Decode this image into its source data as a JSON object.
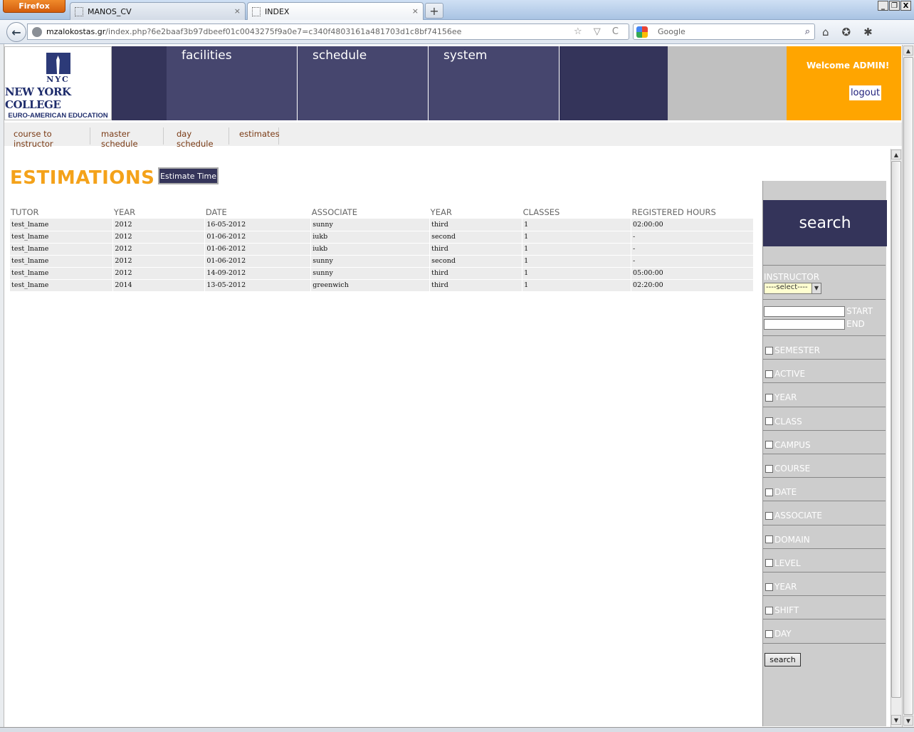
{
  "browser": {
    "app_button": "Firefox",
    "tabs": [
      {
        "label": "MANOS_CV",
        "close": "×"
      },
      {
        "label": "INDEX",
        "close": "×"
      }
    ],
    "new_tab": "+",
    "back": "←",
    "url_host": "mzalokostas.gr",
    "url_path": "/index.php?6e2baaf3b97dbeef01c0043275f9a0e7=c340f4803161a481703d1c8bf74156ee",
    "url_icons": "☆ ▽ C",
    "search_engine": "Google",
    "search_icon": "⌕",
    "window_buttons": [
      "_",
      "❐",
      "X"
    ],
    "tool_icons": [
      "⌂",
      "✪",
      "✱"
    ]
  },
  "logo": {
    "nyc": "NYC",
    "title": "NEW YORK COLLEGE",
    "subtitle": "EURO-AMERICAN EDUCATION"
  },
  "header": {
    "nav": [
      "facilities",
      "schedule",
      "system"
    ],
    "welcome": "Welcome ADMIN!",
    "logout": "logout"
  },
  "subnav": [
    "course to instructor",
    "master schedule",
    "day schedule",
    "estimates"
  ],
  "main": {
    "title": "ESTIMATIONS",
    "estimate_button": "Estimate Time",
    "columns": [
      "TUTOR",
      "YEAR",
      "DATE",
      "ASSOCIATE",
      "YEAR",
      "CLASSES",
      "REGISTERED HOURS"
    ],
    "rows": [
      [
        "test_lname",
        "2012",
        "16-05-2012",
        "sunny",
        "third",
        "1",
        "02:00:00"
      ],
      [
        "test_lname",
        "2012",
        "01-06-2012",
        "iukb",
        "second",
        "1",
        "-"
      ],
      [
        "test_lname",
        "2012",
        "01-06-2012",
        "iukb",
        "third",
        "1",
        "-"
      ],
      [
        "test_lname",
        "2012",
        "01-06-2012",
        "sunny",
        "second",
        "1",
        "-"
      ],
      [
        "test_lname",
        "2012",
        "14-09-2012",
        "sunny",
        "third",
        "1",
        "05:00:00"
      ],
      [
        "test_lname",
        "2014",
        "13-05-2012",
        "greenwich",
        "third",
        "1",
        "02:20:00"
      ]
    ]
  },
  "sidebar": {
    "title": "search",
    "instructor_label": "INSTRUCTOR",
    "instructor_select": "----select----",
    "start_label": "START",
    "end_label": "END",
    "filters": [
      "SEMESTER",
      "ACTIVE",
      "YEAR",
      "CLASS",
      "CAMPUS",
      "COURSE",
      "DATE",
      "ASSOCIATE",
      "DOMAIN",
      "LEVEL",
      "YEAR",
      "SHIFT",
      "DAY"
    ],
    "search_button": "search"
  },
  "colors": {
    "orange": "#ffa500",
    "navy": "#34345a",
    "nav": "#46466e",
    "title": "#f4a21a",
    "link": "#7a3a14"
  }
}
